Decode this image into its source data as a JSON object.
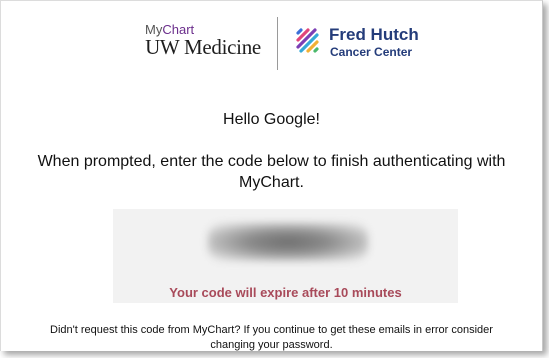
{
  "header": {
    "mychart_prefix": "My",
    "mychart_suffix": "Chart",
    "uw_medicine": "UW Medicine",
    "fred_hutch_name": "Fred Hutch",
    "fred_hutch_sub": "Cancer Center"
  },
  "body": {
    "greeting": "Hello Google!",
    "instruction": "When prompted, enter the code below to finish authenticating with MyChart.",
    "expire_notice": "Your code will expire after 10 minutes",
    "footer_note": "Didn't request this code from MyChart? If you continue to get these emails in error consider changing your password."
  },
  "colors": {
    "mychart_purple": "#6b2e8c",
    "fred_hutch_navy": "#243c7a",
    "expire_red": "#a84a5a",
    "code_box_bg": "#f2f2f2"
  },
  "icons": {
    "fred_hutch_mark": "fred-hutch-logo-icon"
  }
}
